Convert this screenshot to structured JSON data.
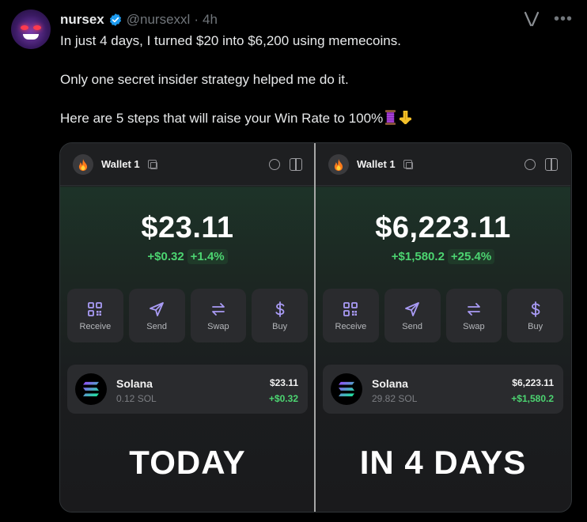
{
  "author": {
    "name": "nursex",
    "handle": "@nursexxl",
    "separator": "·",
    "time": "4h"
  },
  "tweet": {
    "line1": "In just 4 days, I turned $20 into $6,200 using memecoins.",
    "line2": "Only one secret insider strategy helped me do it.",
    "line3": "Here are 5 steps that will raise your Win Rate to 100%"
  },
  "icons": {
    "verified": "verified-badge-icon",
    "grok": "grok-icon",
    "more": "more-icon",
    "emoji1": "thread-spool-emoji",
    "emoji2": "pointing-down-emoji"
  },
  "colors": {
    "accent_green": "#4cd471",
    "verified_blue": "#1d9bf0"
  },
  "panels": [
    {
      "wallet_name": "Wallet 1",
      "balance": "$23.11",
      "change_abs": "+$0.32",
      "change_pct": "+1.4%",
      "actions": [
        "Receive",
        "Send",
        "Swap",
        "Buy"
      ],
      "token": {
        "name": "Solana",
        "amount": "0.12 SOL",
        "value": "$23.11",
        "change": "+$0.32"
      },
      "caption": "TODAY"
    },
    {
      "wallet_name": "Wallet 1",
      "balance": "$6,223.11",
      "change_abs": "+$1,580.2",
      "change_pct": "+25.4%",
      "actions": [
        "Receive",
        "Send",
        "Swap",
        "Buy"
      ],
      "token": {
        "name": "Solana",
        "amount": "29.82 SOL",
        "value": "$6,223.11",
        "change": "+$1,580.2"
      },
      "caption": "IN 4 DAYS"
    }
  ]
}
